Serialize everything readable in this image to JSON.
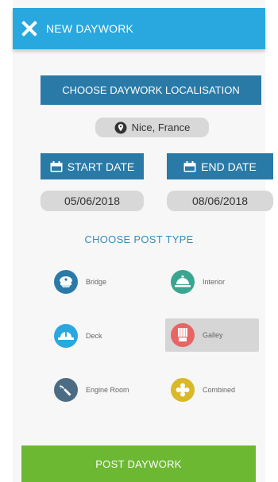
{
  "header": {
    "title": "NEW DAYWORK"
  },
  "location": {
    "button_label": "CHOOSE DAYWORK LOCALISATION",
    "value": "Nice, France"
  },
  "dates": {
    "start_label": "START DATE",
    "start_value": "05/06/2018",
    "end_label": "END DATE",
    "end_value": "08/06/2018"
  },
  "post_type": {
    "title": "CHOOSE POST TYPE",
    "items": [
      {
        "label": "Bridge",
        "icon": "captain-hat-icon",
        "color": "#2a7aa8"
      },
      {
        "label": "Interior",
        "icon": "service-bell-icon",
        "color": "#3aa68f"
      },
      {
        "label": "Deck",
        "icon": "hard-hat-icon",
        "color": "#29a8df"
      },
      {
        "label": "Galley",
        "icon": "chef-hat-icon",
        "color": "#e76565",
        "selected": true
      },
      {
        "label": "Engine Room",
        "icon": "wrench-icon",
        "color": "#4b6c84"
      },
      {
        "label": "Combined",
        "icon": "combined-icon",
        "color": "#d9b82a"
      }
    ]
  },
  "footer": {
    "post_label": "POST DAYWORK"
  },
  "colors": {
    "header": "#29a8df",
    "primary": "#2a7aa8",
    "post_button": "#6cb833",
    "pill": "#d8d8d8"
  }
}
